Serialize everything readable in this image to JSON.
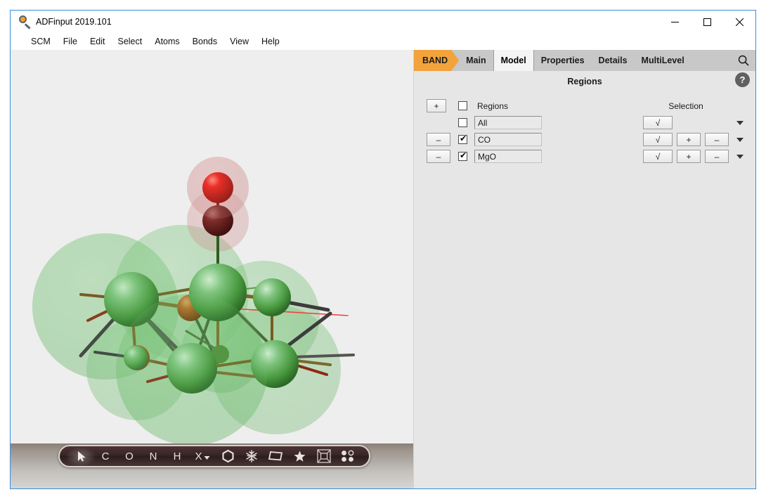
{
  "window": {
    "title": "ADFinput 2019.101",
    "icon": "magnifier-icon",
    "minimize": "–",
    "maximize": "☐",
    "close": "✕"
  },
  "menubar": {
    "items": [
      {
        "label": "SCM"
      },
      {
        "label": "File"
      },
      {
        "label": "Edit"
      },
      {
        "label": "Select"
      },
      {
        "label": "Atoms"
      },
      {
        "label": "Bonds"
      },
      {
        "label": "View"
      },
      {
        "label": "Help"
      }
    ]
  },
  "tabs": {
    "brand": "BAND",
    "items": [
      {
        "label": "Main",
        "active": false
      },
      {
        "label": "Model",
        "active": true
      },
      {
        "label": "Properties",
        "active": false
      },
      {
        "label": "Details",
        "active": false
      },
      {
        "label": "MultiLevel",
        "active": false
      }
    ],
    "search_icon": "search-icon"
  },
  "section": {
    "title": "Regions",
    "help_label": "?"
  },
  "regions_panel": {
    "add_button": "+",
    "header_checkbox_checked": false,
    "column_regions": "Regions",
    "column_selection": "Selection",
    "remove_symbol": "–",
    "check_symbol": "√",
    "plus_symbol": "+",
    "minus_symbol": "–",
    "rows": [
      {
        "name": "All",
        "checked": false,
        "has_remove": false,
        "has_plus_minus": false
      },
      {
        "name": "CO",
        "checked": true,
        "has_remove": true,
        "has_plus_minus": true
      },
      {
        "name": "MgO",
        "checked": true,
        "has_remove": true,
        "has_plus_minus": true
      }
    ]
  },
  "toolbar": {
    "items": [
      {
        "name": "select-cursor-tool",
        "glyph": "➤",
        "kind": "cursor"
      },
      {
        "name": "carbon-atom-tool",
        "glyph": "C",
        "kind": "letter"
      },
      {
        "name": "oxygen-atom-tool",
        "glyph": "O",
        "kind": "letter"
      },
      {
        "name": "nitrogen-atom-tool",
        "glyph": "N",
        "kind": "letter"
      },
      {
        "name": "hydrogen-atom-tool",
        "glyph": "H",
        "kind": "letter"
      },
      {
        "name": "other-element-tool",
        "glyph": "X",
        "kind": "letter-dropdown"
      },
      {
        "name": "benzene-ring-tool",
        "glyph": "⬡",
        "kind": "hexagon"
      },
      {
        "name": "snowflake-tool",
        "glyph": "❄",
        "kind": "snowflake"
      },
      {
        "name": "plane-slab-tool",
        "glyph": "▱",
        "kind": "parallelogram"
      },
      {
        "name": "star-tool",
        "glyph": "★",
        "kind": "star"
      },
      {
        "name": "unit-cell-tool",
        "glyph": "⧉",
        "kind": "cell"
      },
      {
        "name": "dots-tool",
        "glyph": "∷",
        "kind": "dots"
      }
    ]
  },
  "colors": {
    "brand_orange": "#f2a33c",
    "window_border": "#3a8dde",
    "panel_bg": "#e6e6e6",
    "viewport_bg": "#eeeeee",
    "magnesium_green": "#4c9c4c",
    "oxygen_brown": "#a05a1e",
    "oxygen_red": "#e01010",
    "carbon_dark_red": "#6b2222",
    "region_green": "#6fbf6f",
    "region_pink": "#c98a8a"
  },
  "structure": {
    "description": "MgO slab with adsorbed CO molecule",
    "regions_shown": [
      "CO",
      "MgO"
    ]
  }
}
